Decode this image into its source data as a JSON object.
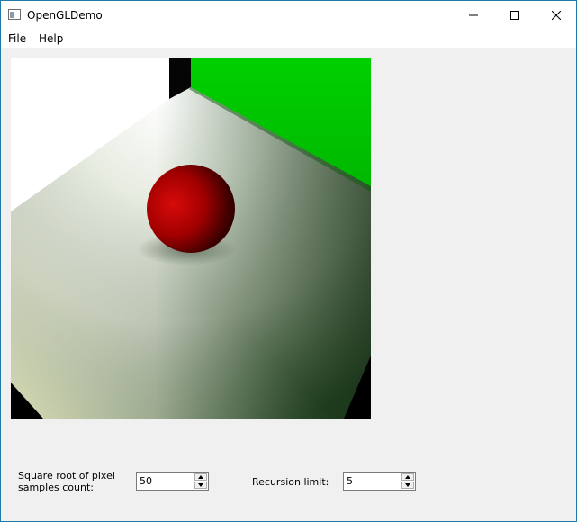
{
  "window": {
    "title": "OpenGLDemo",
    "icon": "app-window-icon",
    "controls": [
      "minimize-icon",
      "maximize-icon",
      "close-icon"
    ]
  },
  "menu": {
    "file": "File",
    "help": "Help"
  },
  "render": {
    "description_icon": "rendered-scene",
    "colors": {
      "floor": "#b8c0b0",
      "wall_left": "#ffffff",
      "wall_right": "#00cc00",
      "sphere": "#c00000",
      "corner": "#000000"
    }
  },
  "controls": {
    "samples_label": "Square root of pixel samples count:",
    "samples_value": "50",
    "recursion_label": "Recursion limit:",
    "recursion_value": "5"
  },
  "colors": {
    "window_border": "#1f7aa8",
    "background": "#f0f0f0"
  }
}
